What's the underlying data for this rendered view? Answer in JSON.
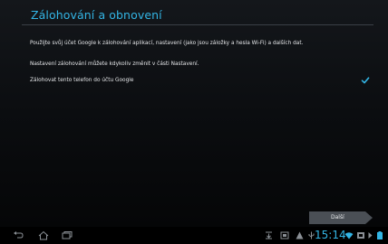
{
  "header": {
    "title": "Zálohování a obnovení"
  },
  "content": {
    "paragraph1": "Použijte svůj účet Google k zálohování aplikací, nastavení (jako jsou záložky a hesla Wi-Fi) a dalších dat.",
    "paragraph2": "Nastavení zálohování můžete kdykoliv změnit v části Nastavení.",
    "backup_option": {
      "label": "Zálohovat tento telefon do účtu Google",
      "checked": true
    }
  },
  "footer": {
    "next_label": "Další"
  },
  "navbar": {
    "icons": [
      "back-icon",
      "home-icon",
      "recent-apps-icon"
    ],
    "status_icons": [
      "download-notification-icon",
      "screenshot-icon",
      "warning-icon",
      "usb-icon",
      "wifi-icon",
      "sim-icon",
      "battery-icon"
    ],
    "time": "15:14"
  },
  "colors": {
    "accent": "#33b5e5",
    "background": "#0b0d10"
  }
}
